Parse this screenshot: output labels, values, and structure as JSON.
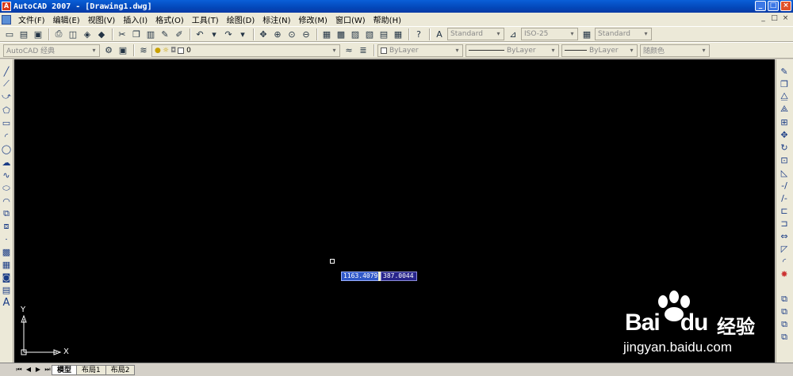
{
  "window": {
    "title": "AutoCAD 2007 - [Drawing1.dwg]",
    "minimize": "_",
    "maximize": "□",
    "close": "×"
  },
  "menu": {
    "items": [
      "文件(F)",
      "编辑(E)",
      "视图(V)",
      "插入(I)",
      "格式(O)",
      "工具(T)",
      "绘图(D)",
      "标注(N)",
      "修改(M)",
      "窗口(W)",
      "帮助(H)"
    ]
  },
  "toolbar1": {
    "text_style": "Standard",
    "dim_style": "ISO-25",
    "table_style": "Standard"
  },
  "toolbar2": {
    "workspace": "AutoCAD 经典",
    "layer": "0",
    "color": "ByLayer",
    "linetype": "ByLayer",
    "lineweight": "ByLayer",
    "plot_style": "随颜色"
  },
  "canvas": {
    "background": "#000000",
    "coord_x": "1163.4079",
    "coord_y": "387.0044",
    "ucs_x_label": "X",
    "ucs_y_label": "Y"
  },
  "tabs": {
    "items": [
      "模型",
      "布局1",
      "布局2"
    ],
    "active": "模型"
  },
  "watermark": {
    "brand": "Bai",
    "brand_suffix": "du",
    "jingyan": "经验",
    "url": "jingyan.baidu.com"
  }
}
